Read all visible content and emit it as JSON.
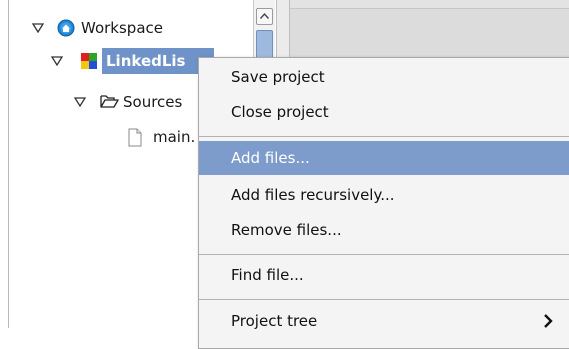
{
  "tree": {
    "items": [
      {
        "label": "Workspace",
        "icon": "workspace-icon",
        "expanded": true
      },
      {
        "label": "LinkedLis",
        "icon": "project-icon",
        "expanded": true,
        "selected": true
      },
      {
        "label": "Sources",
        "icon": "folder-open-icon",
        "expanded": true
      },
      {
        "label": "main.",
        "icon": "file-icon"
      }
    ]
  },
  "menu": {
    "items": [
      {
        "label": "Save project"
      },
      {
        "label": "Close project"
      },
      {
        "label": "Add files..."
      },
      {
        "label": "Add files recursively..."
      },
      {
        "label": "Remove files..."
      },
      {
        "label": "Find file..."
      },
      {
        "label": "Project tree",
        "submenu": true
      }
    ]
  },
  "colors": {
    "selection": "#6f93c8",
    "menu_highlight": "#7d9ccb",
    "workspace_icon": "#1f86d6"
  },
  "icons": {
    "expand": "triangle-down-icon",
    "submenu": "chevron-right-icon",
    "scroll_up": "arrow-up-icon"
  }
}
